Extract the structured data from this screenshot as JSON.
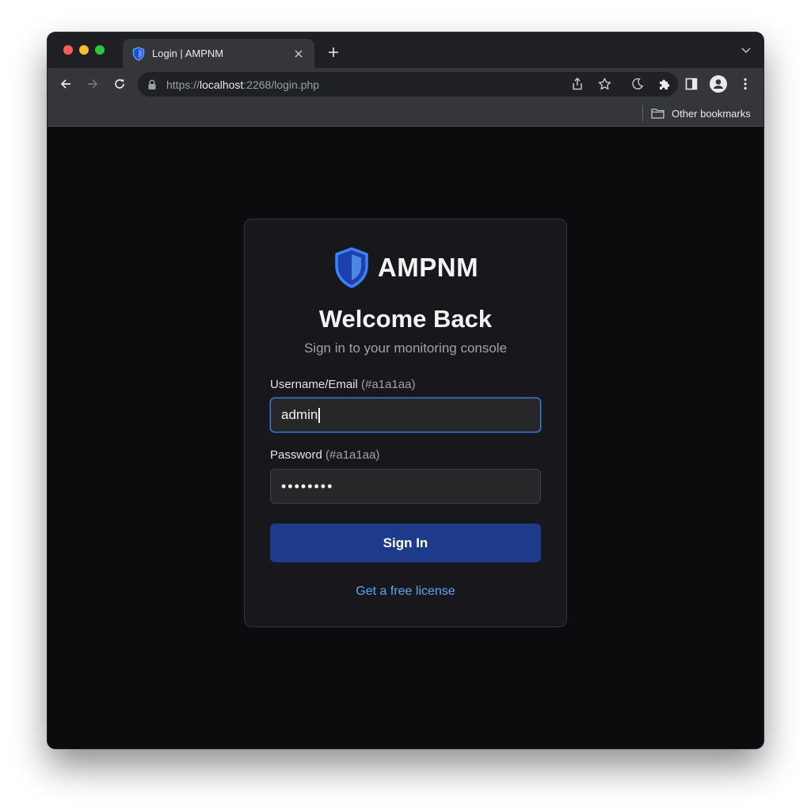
{
  "browser": {
    "tab": {
      "title": "Login | AMPNM",
      "favicon": "shield-icon"
    },
    "toolbar": {
      "url_prefix": "https://",
      "url_host": "localhost",
      "url_rest": ":2268/login.php"
    },
    "bookmarks": {
      "other_label": "Other bookmarks"
    }
  },
  "login": {
    "brand": "AMPNM",
    "heading": "Welcome Back",
    "subtitle": "Sign in to your monitoring console",
    "username_label": "Username/Email",
    "username_hint": "(#a1a1aa)",
    "username_value": "admin",
    "password_label": "Password",
    "password_hint": "(#a1a1aa)",
    "password_mask": "••••••••",
    "signin_label": "Sign In",
    "license_link": "Get a free license"
  },
  "colors": {
    "accent_blue": "#3b82f6",
    "button_blue": "#1e3a8a",
    "link_blue": "#60a5fa",
    "card_bg": "#18181c",
    "page_bg": "#0c0c0f"
  }
}
